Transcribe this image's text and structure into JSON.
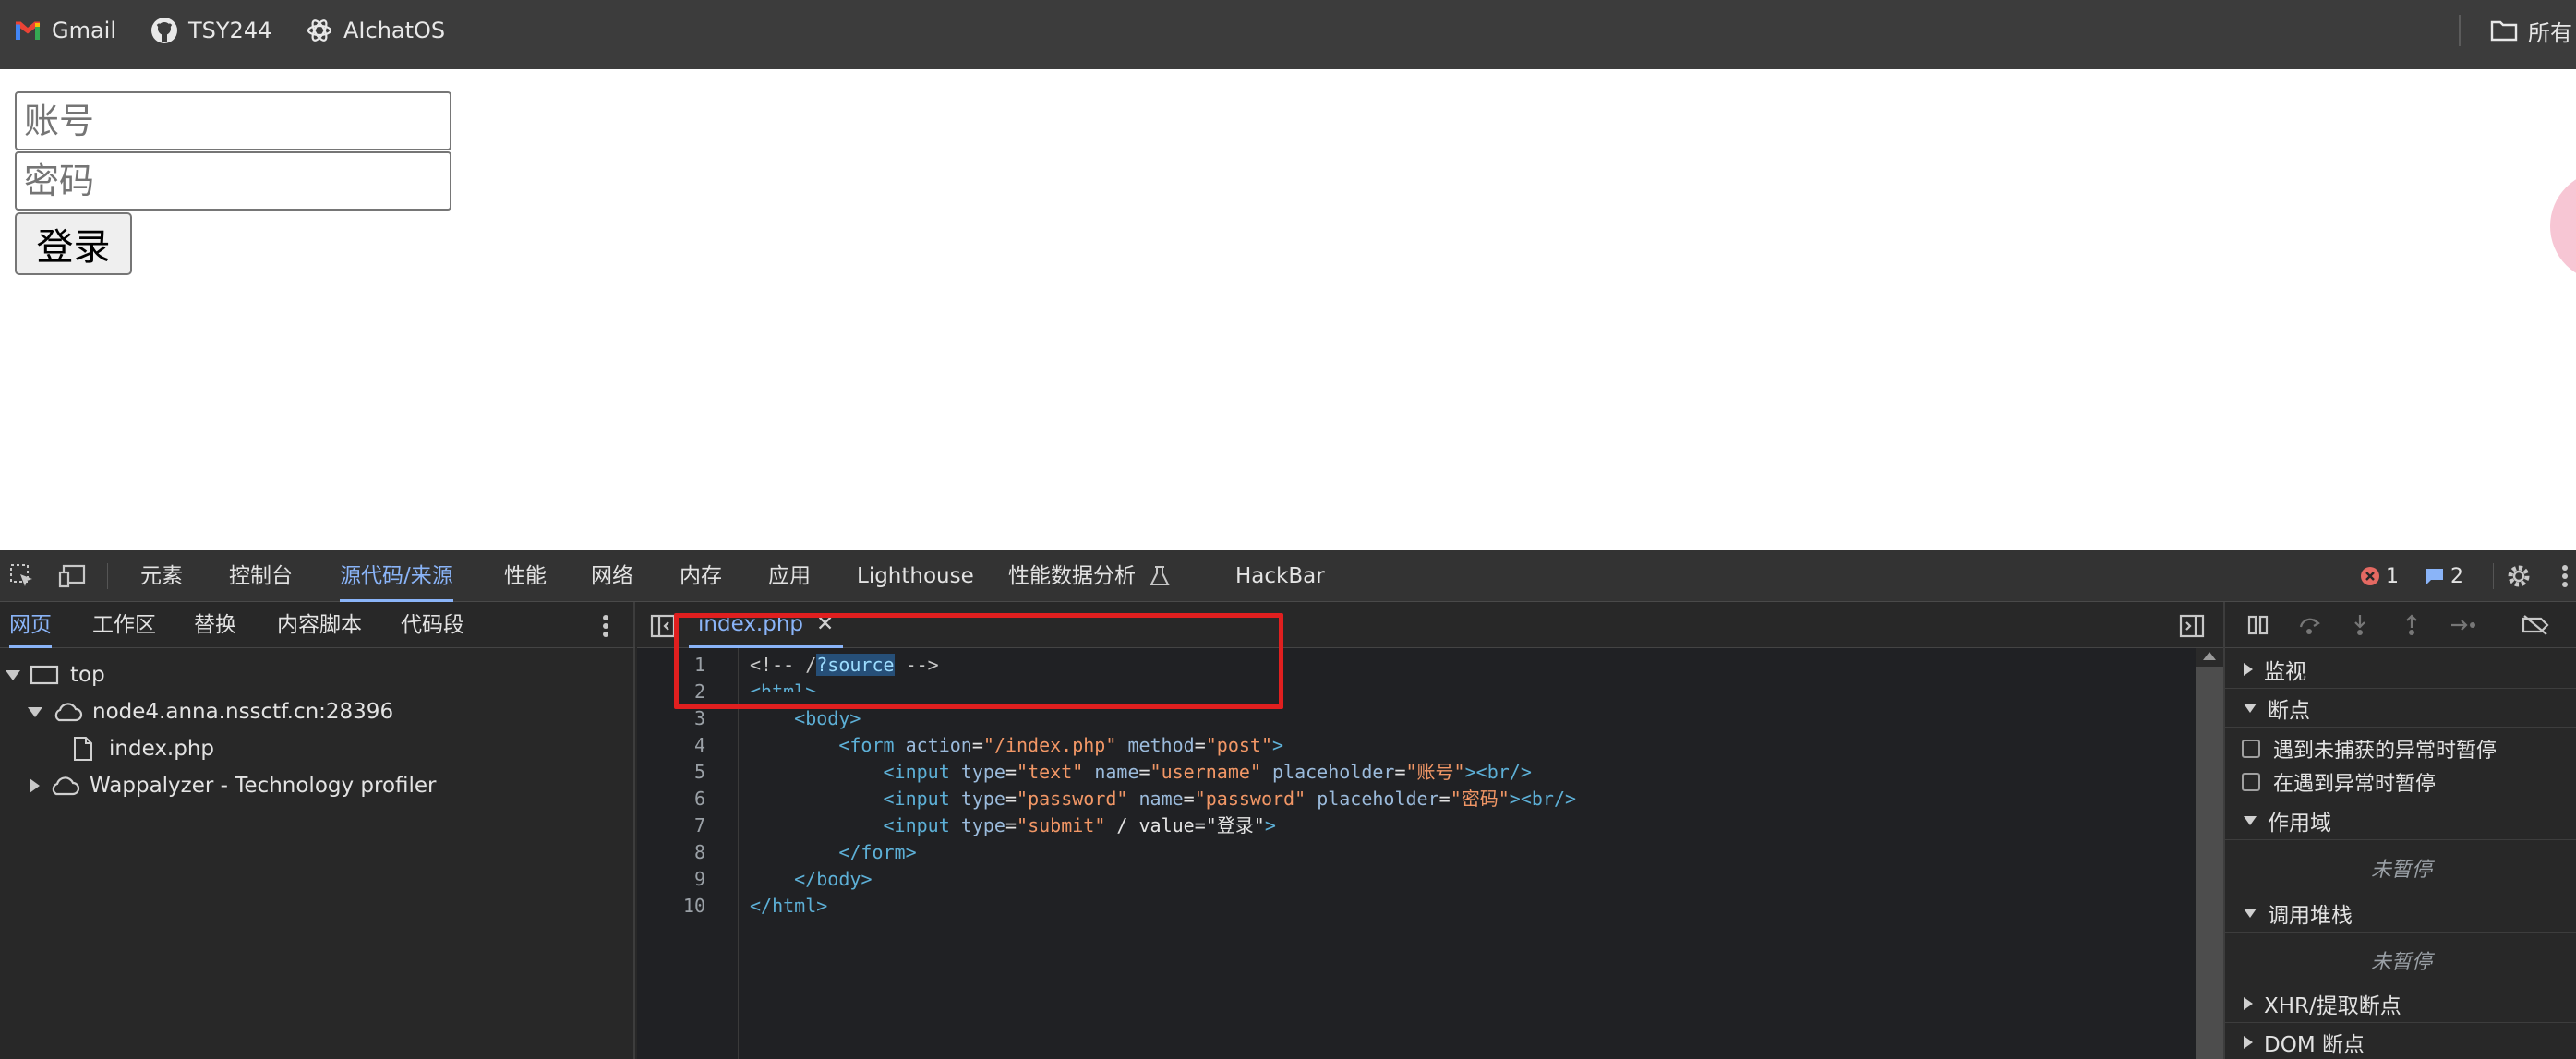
{
  "bookmarks": {
    "items": [
      {
        "label": "Gmail",
        "icon": "gmail-icon"
      },
      {
        "label": "TSY244",
        "icon": "github-icon"
      },
      {
        "label": "AIchatOS",
        "icon": "openai-icon"
      }
    ],
    "all_bookmarks_label": "所有"
  },
  "page": {
    "account_placeholder": "账号",
    "password_placeholder": "密码",
    "login_label": "登录"
  },
  "devtools": {
    "tabs": [
      "元素",
      "控制台",
      "源代码/来源",
      "性能",
      "网络",
      "内存",
      "应用",
      "Lighthouse",
      "性能数据分析",
      "HackBar"
    ],
    "active_tab": "源代码/来源",
    "error_count": "1",
    "message_count": "2",
    "navigator": {
      "tabs": [
        "网页",
        "工作区",
        "替换",
        "内容脚本",
        "代码段"
      ],
      "tree": [
        {
          "label": "top"
        },
        {
          "label": "node4.anna.nssctf.cn:28396"
        },
        {
          "label": "index.php"
        },
        {
          "label": "Wappalyzer - Technology profiler"
        }
      ]
    },
    "editor": {
      "file_tab": "index.php",
      "line_numbers": [
        "1",
        "2",
        "3",
        "4",
        "5",
        "6",
        "7",
        "8",
        "9",
        "10"
      ]
    },
    "debugger": {
      "sections": {
        "watch": "监视",
        "breakpoints": "断点",
        "pause_uncaught": "遇到未捕获的异常时暂停",
        "pause_caught": "在遇到异常时暂停",
        "scope": "作用域",
        "not_paused_1": "未暂停",
        "call_stack": "调用堆栈",
        "not_paused_2": "未暂停",
        "xhr_breakpoints": "XHR/提取断点",
        "dom_breakpoints": "DOM 断点"
      }
    }
  },
  "code": {
    "l1_comment_start": "<!-- /",
    "l1_selected": "?source",
    "l1_comment_end": " -->",
    "l2": "<html>",
    "tag_body": "body",
    "tag_form": "form",
    "tag_input": "input",
    "tag_br": "br",
    "tag_html": "html",
    "attr_action": "action",
    "val_action": "\"/index.php\"",
    "attr_method": "method",
    "val_method": "\"post\"",
    "attr_type": "type",
    "val_text": "\"text\"",
    "attr_name": "name",
    "val_username": "\"username\"",
    "attr_placeholder": "placeholder",
    "val_account": "\"账号\"",
    "val_password_type": "\"password\"",
    "val_password_name": "\"password\"",
    "val_pw_ph": "\"密码\"",
    "val_submit": "\"submit\"",
    "l7_slash": " / ",
    "attr_value": "value",
    "val_login": "\"登录\""
  }
}
